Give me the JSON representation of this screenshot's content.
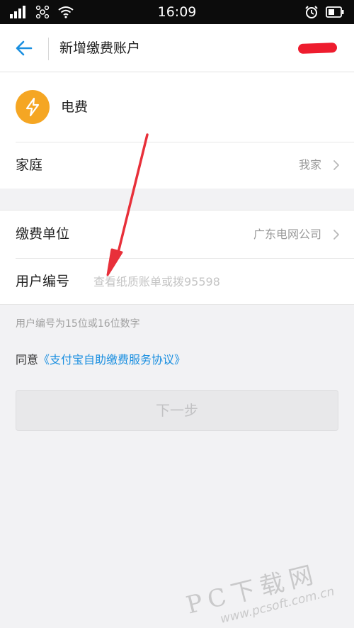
{
  "status_bar": {
    "time": "16:09"
  },
  "header": {
    "title": "新增缴费账户"
  },
  "service": {
    "label": "电费",
    "icon": "lightning-icon",
    "icon_color": "#f5a623"
  },
  "group": {
    "label": "家庭",
    "value": "我家"
  },
  "billing_unit": {
    "label": "缴费单位",
    "value": "广东电网公司"
  },
  "account_number": {
    "label": "用户编号",
    "placeholder": "查看纸质账单或拨95598",
    "value": ""
  },
  "hint": "用户编号为15位或16位数字",
  "agreement": {
    "prefix": "同意",
    "link": "《支付宝自助缴费服务协议》"
  },
  "next_button": {
    "label": "下一步"
  },
  "watermark": {
    "main": "PC下载网",
    "url": "www.pcsoft.com.cn"
  },
  "colors": {
    "accent": "#1a8fe0",
    "annotation_arrow": "#e8303a",
    "redaction": "#ee1c2e"
  }
}
